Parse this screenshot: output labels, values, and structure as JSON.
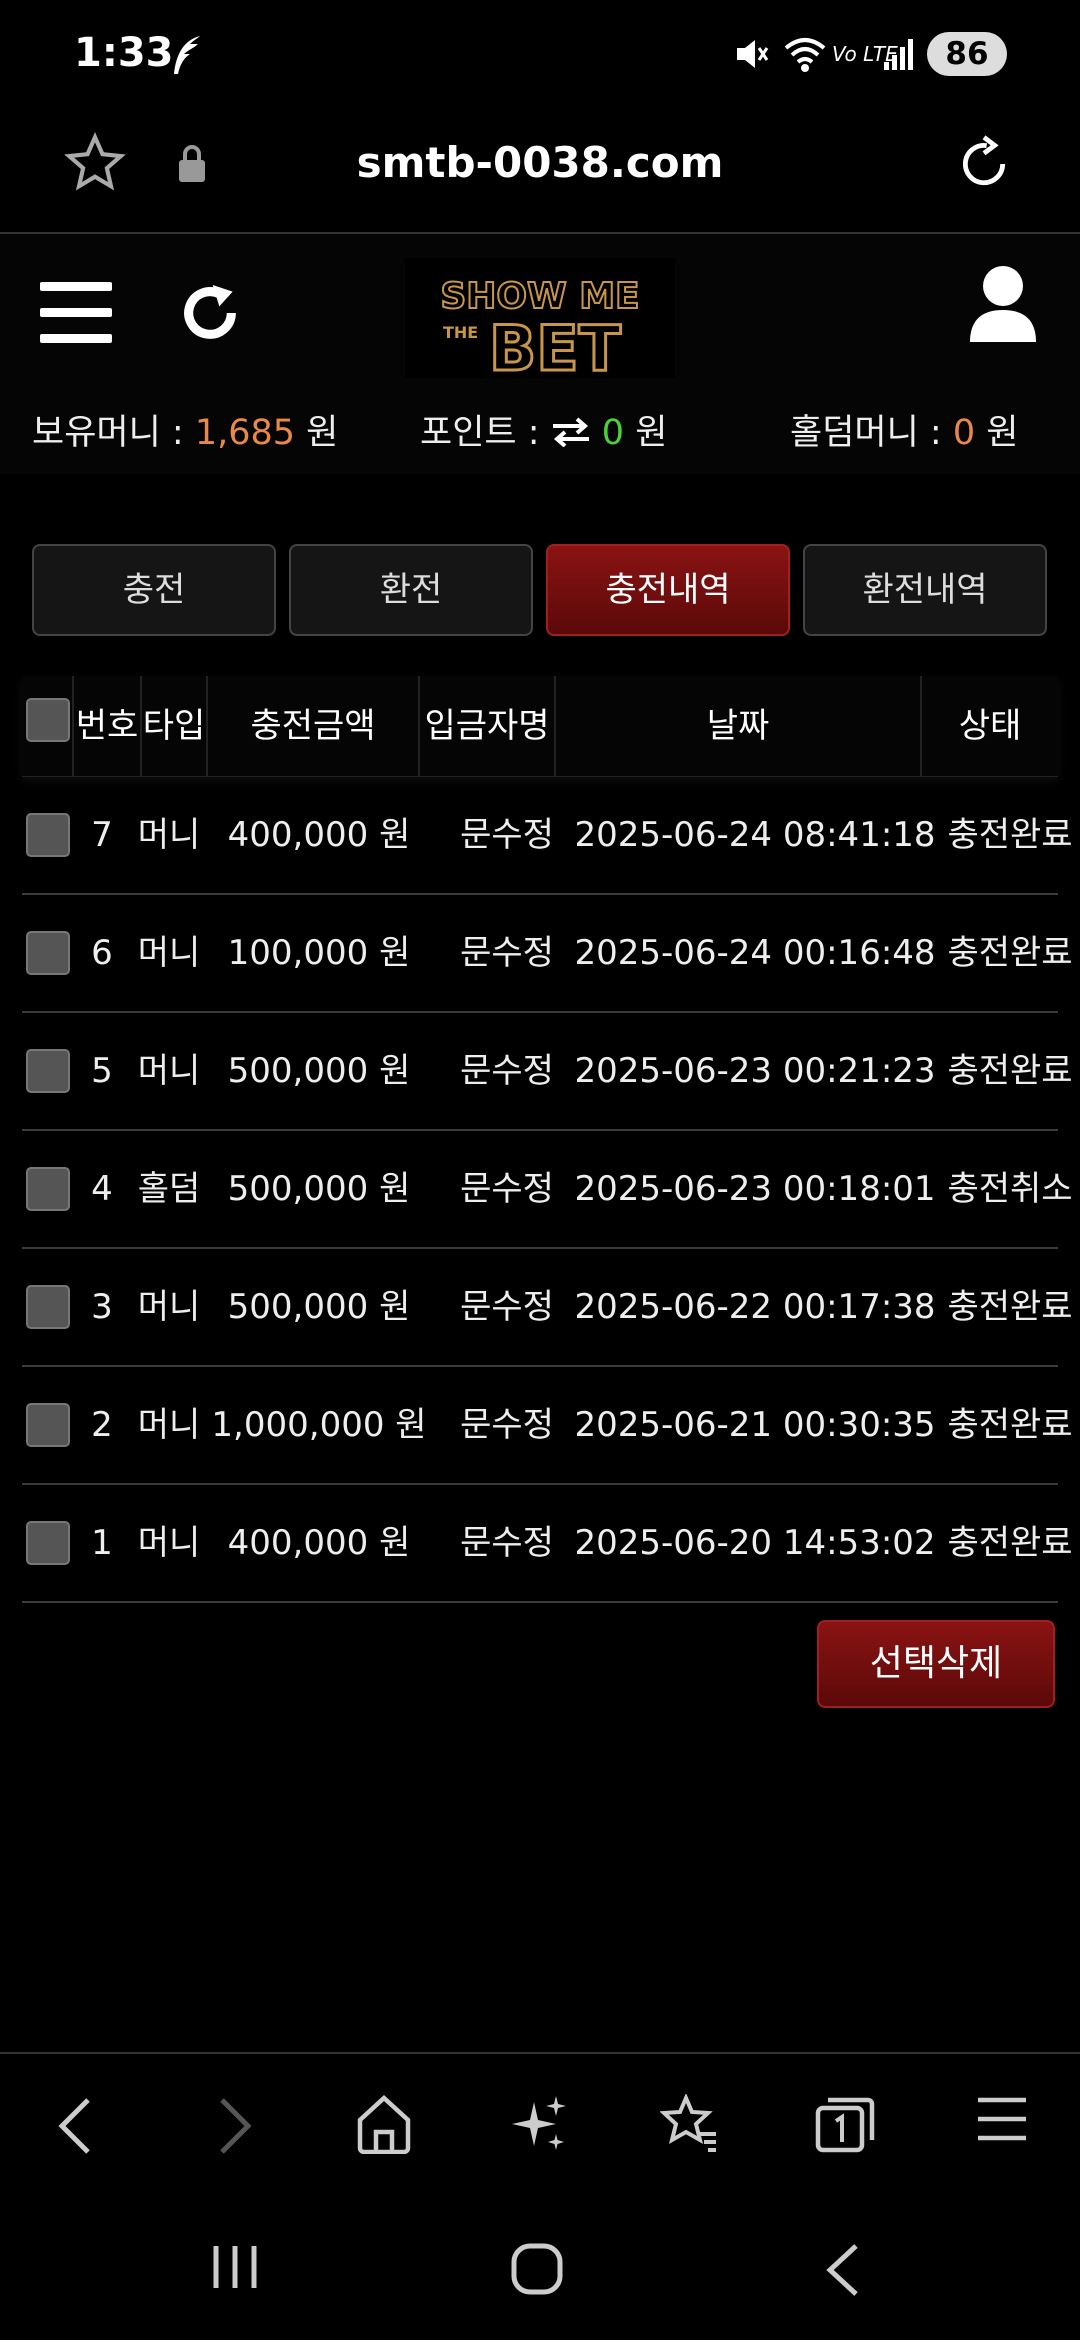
{
  "status_bar": {
    "time": "1:33",
    "battery": "86",
    "network": "Vo LTE"
  },
  "browser": {
    "url": "smtb-0038.com"
  },
  "site": {
    "logo_text": "SHOW ME THE BET",
    "balances": {
      "money_label": "보유머니 : ",
      "money_value": "1,685",
      "money_unit": " 원",
      "point_label": "포인트 : ",
      "point_value": "0",
      "point_unit": " 원",
      "holdem_label": "홀덤머니 : ",
      "holdem_value": "0",
      "holdem_unit": " 원"
    }
  },
  "tabs": [
    {
      "label": "충전",
      "active": false
    },
    {
      "label": "환전",
      "active": false
    },
    {
      "label": "충전내역",
      "active": true
    },
    {
      "label": "환전내역",
      "active": false
    }
  ],
  "table": {
    "headers": {
      "no": "번호",
      "type": "타입",
      "amount": "충전금액",
      "depositor": "입금자명",
      "date": "날짜",
      "status": "상태"
    },
    "rows": [
      {
        "no": "7",
        "type": "머니",
        "amount": "400,000 원",
        "depositor": "문수정",
        "date": "2025-06-24 08:41:18",
        "status": "충전완료"
      },
      {
        "no": "6",
        "type": "머니",
        "amount": "100,000 원",
        "depositor": "문수정",
        "date": "2025-06-24 00:16:48",
        "status": "충전완료"
      },
      {
        "no": "5",
        "type": "머니",
        "amount": "500,000 원",
        "depositor": "문수정",
        "date": "2025-06-23 00:21:23",
        "status": "충전완료"
      },
      {
        "no": "4",
        "type": "홀덤",
        "amount": "500,000 원",
        "depositor": "문수정",
        "date": "2025-06-23 00:18:01",
        "status": "충전취소"
      },
      {
        "no": "3",
        "type": "머니",
        "amount": "500,000 원",
        "depositor": "문수정",
        "date": "2025-06-22 00:17:38",
        "status": "충전완료"
      },
      {
        "no": "2",
        "type": "머니",
        "amount": "1,000,000 원",
        "depositor": "문수정",
        "date": "2025-06-21 00:30:35",
        "status": "충전완료"
      },
      {
        "no": "1",
        "type": "머니",
        "amount": "400,000 원",
        "depositor": "문수정",
        "date": "2025-06-20 14:53:02",
        "status": "충전완료"
      }
    ]
  },
  "actions": {
    "delete_selected": "선택삭제"
  },
  "colors": {
    "accent_red": "#8a1313",
    "balance_orange": "#e88a45",
    "point_green": "#4cd137",
    "logo_gold": "#c8964a"
  },
  "icons": {
    "status": [
      "feather-icon",
      "mute-icon",
      "wifi-icon",
      "signal-icon",
      "battery-icon"
    ],
    "browser": [
      "star-icon",
      "lock-icon",
      "reload-icon"
    ],
    "header": [
      "menu-icon",
      "refresh-icon",
      "user-icon"
    ],
    "bottom_nav": [
      "back-icon",
      "forward-icon",
      "home-icon",
      "sparkle-icon",
      "bookmarks-icon",
      "tabs-icon",
      "menu-icon"
    ],
    "system_nav": [
      "recents-icon",
      "home-icon",
      "back-icon"
    ]
  }
}
